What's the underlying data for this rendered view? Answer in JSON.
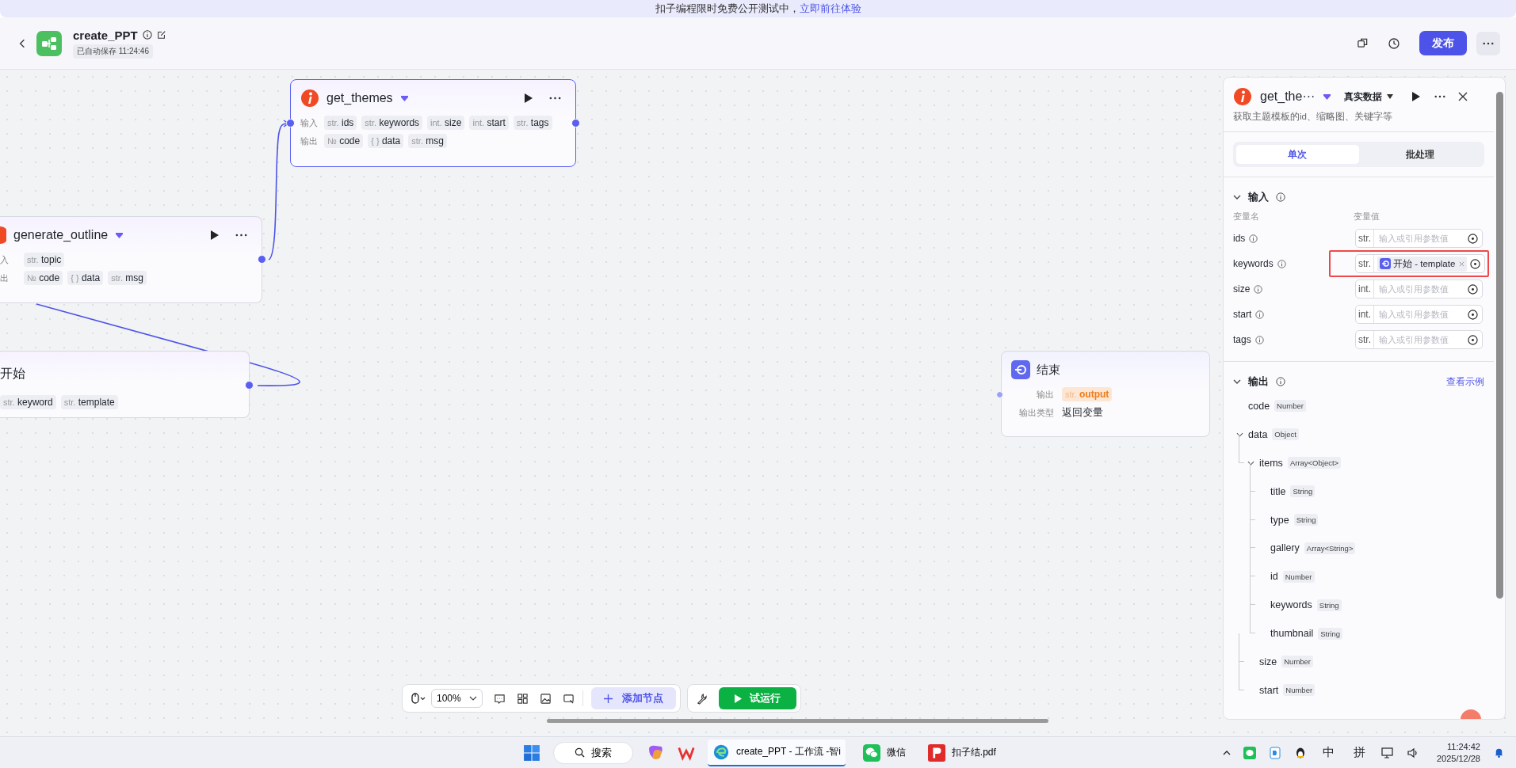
{
  "banner": {
    "text": "扣子编程限时免费公开测试中，",
    "link": "立即前往体验"
  },
  "header": {
    "title": "create_PPT",
    "saved": "已自动保存 11:24:46",
    "publish": "发布"
  },
  "nodes": [
    {
      "kind": "plugin",
      "title": "get_themes",
      "selected": true,
      "rows": [
        {
          "label": "输入",
          "chips": [
            {
              "type": "str.",
              "name": "ids"
            },
            {
              "type": "str.",
              "name": "keywords"
            },
            {
              "type": "int.",
              "name": "size"
            },
            {
              "type": "int.",
              "name": "start"
            },
            {
              "type": "str.",
              "name": "tags"
            }
          ]
        },
        {
          "label": "输出",
          "chips": [
            {
              "type": "№",
              "name": "code"
            },
            {
              "type": "{ }",
              "name": "data"
            },
            {
              "type": "str.",
              "name": "msg"
            }
          ]
        }
      ]
    },
    {
      "kind": "plugin",
      "title": "generate_outline",
      "selected": false,
      "rows": [
        {
          "label": "入",
          "chips": [
            {
              "type": "str.",
              "name": "topic"
            }
          ]
        },
        {
          "label": "出",
          "chips": [
            {
              "type": "№",
              "name": "code"
            },
            {
              "type": "{ }",
              "name": "data"
            },
            {
              "type": "str.",
              "name": "msg"
            }
          ]
        }
      ]
    },
    {
      "kind": "start",
      "title": "开始",
      "selected": false,
      "rows": [
        {
          "chips": [
            {
              "type": "str.",
              "name": "keyword"
            },
            {
              "type": "str.",
              "name": "template"
            }
          ]
        }
      ]
    },
    {
      "kind": "end",
      "title": "结束",
      "selected": false,
      "rows": [
        {
          "label": "输出",
          "chips": [
            {
              "type": "str.",
              "name": "output"
            }
          ]
        },
        {
          "label": "输出类型",
          "value": "返回变量"
        }
      ]
    }
  ],
  "panel": {
    "title": "get_the···",
    "mode": "真实数据",
    "description": "获取主题模板的id、缩略图、关键字等",
    "tabs": [
      {
        "label": "单次",
        "selected": true
      },
      {
        "label": "批处理",
        "selected": false
      }
    ],
    "input": {
      "title": "输入",
      "expanded": true,
      "name_header": "变量名",
      "value_header": "变量值",
      "params": [
        {
          "name": "ids",
          "type": "str.",
          "placeholder": "输入或引用参数值",
          "highlighted": false
        },
        {
          "name": "keywords",
          "type": "str.",
          "ref": "开始 - template",
          "highlighted": true
        },
        {
          "name": "size",
          "type": "int.",
          "placeholder": "输入或引用参数值",
          "highlighted": false
        },
        {
          "name": "start",
          "type": "int.",
          "placeholder": "输入或引用参数值",
          "highlighted": false
        },
        {
          "name": "tags",
          "type": "str.",
          "placeholder": "输入或引用参数值",
          "highlighted": false
        }
      ]
    },
    "output": {
      "title": "输出",
      "expanded": true,
      "link": "查看示例",
      "tree": [
        {
          "name": "code",
          "type": "Number"
        },
        {
          "name": "data",
          "type": "Object",
          "expanded": true,
          "children": [
            {
              "name": "items",
              "type": "Array<Object>",
              "expanded": true,
              "children": [
                {
                  "name": "title",
                  "type": "String"
                },
                {
                  "name": "type",
                  "type": "String"
                },
                {
                  "name": "gallery",
                  "type": "Array<String>"
                },
                {
                  "name": "id",
                  "type": "Number"
                },
                {
                  "name": "keywords",
                  "type": "String"
                },
                {
                  "name": "thumbnail",
                  "type": "String"
                }
              ]
            },
            {
              "name": "size",
              "type": "Number"
            },
            {
              "name": "start",
              "type": "Number"
            }
          ]
        }
      ]
    }
  },
  "toolbar": {
    "zoom": "100%",
    "add_node": "添加节点",
    "test_run": "试运行"
  },
  "taskbar": {
    "search": "搜索",
    "apps": [
      {
        "kind": "browser",
        "label": "create_PPT - 工作流 -智i",
        "selected": true
      },
      {
        "kind": "chat",
        "label": "微信",
        "selected": false
      },
      {
        "kind": "pdf",
        "label": "扣子结.pdf",
        "selected": false
      }
    ],
    "ime": [
      "中",
      "拼"
    ],
    "time": "11:24:42",
    "date": "2025/12/28"
  }
}
